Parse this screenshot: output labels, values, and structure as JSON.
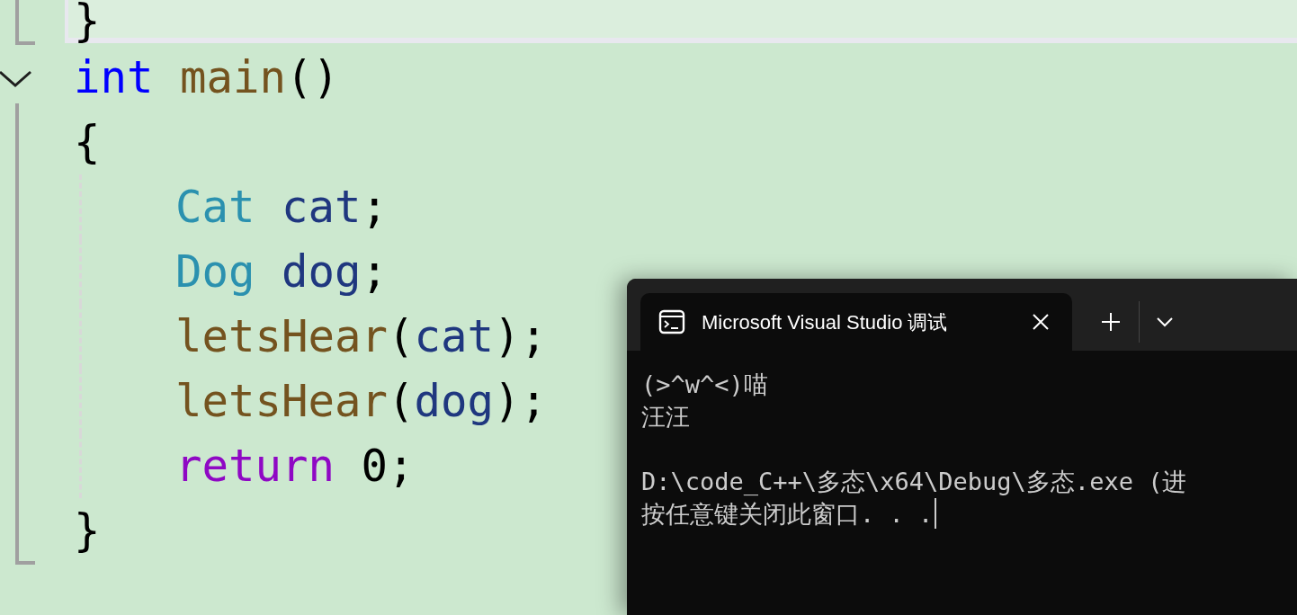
{
  "editor": {
    "lines": [
      {
        "current": true,
        "indented": false,
        "tokens": [
          {
            "text": "}",
            "kind": "punct"
          }
        ]
      },
      {
        "current": false,
        "indented": false,
        "fold_toggle": {
          "expanded": true
        },
        "tokens": [
          {
            "text": "int ",
            "kind": "keyword"
          },
          {
            "text": "main",
            "kind": "function"
          },
          {
            "text": "()",
            "kind": "punct"
          }
        ]
      },
      {
        "current": false,
        "indented": false,
        "tokens": [
          {
            "text": "{",
            "kind": "punct"
          }
        ]
      },
      {
        "current": false,
        "indented": true,
        "tokens": [
          {
            "text": "Cat ",
            "kind": "type"
          },
          {
            "text": "cat",
            "kind": "variable"
          },
          {
            "text": ";",
            "kind": "punct"
          }
        ]
      },
      {
        "current": false,
        "indented": true,
        "tokens": [
          {
            "text": "Dog ",
            "kind": "type"
          },
          {
            "text": "dog",
            "kind": "variable"
          },
          {
            "text": ";",
            "kind": "punct"
          }
        ]
      },
      {
        "current": false,
        "indented": true,
        "tokens": [
          {
            "text": "letsHear",
            "kind": "function"
          },
          {
            "text": "(",
            "kind": "punct"
          },
          {
            "text": "cat",
            "kind": "variable"
          },
          {
            "text": ");",
            "kind": "punct"
          }
        ]
      },
      {
        "current": false,
        "indented": true,
        "tokens": [
          {
            "text": "letsHear",
            "kind": "function"
          },
          {
            "text": "(",
            "kind": "punct"
          },
          {
            "text": "dog",
            "kind": "variable"
          },
          {
            "text": ");",
            "kind": "punct"
          }
        ]
      },
      {
        "current": false,
        "indented": true,
        "tokens": [
          {
            "text": "return ",
            "kind": "control"
          },
          {
            "text": "0",
            "kind": "number"
          },
          {
            "text": ";",
            "kind": "punct"
          }
        ]
      },
      {
        "current": false,
        "indented": false,
        "tokens": [
          {
            "text": "}",
            "kind": "punct"
          }
        ]
      }
    ]
  },
  "terminal": {
    "tab": {
      "title": "Microsoft Visual Studio 调试",
      "selected": true
    },
    "output_blocks": [
      [
        "(>^w^<)喵",
        "汪汪"
      ],
      [
        "D:\\code_C++\\多态\\x64\\Debug\\多态.exe (进",
        "按任意键关闭此窗口. . ."
      ]
    ]
  }
}
